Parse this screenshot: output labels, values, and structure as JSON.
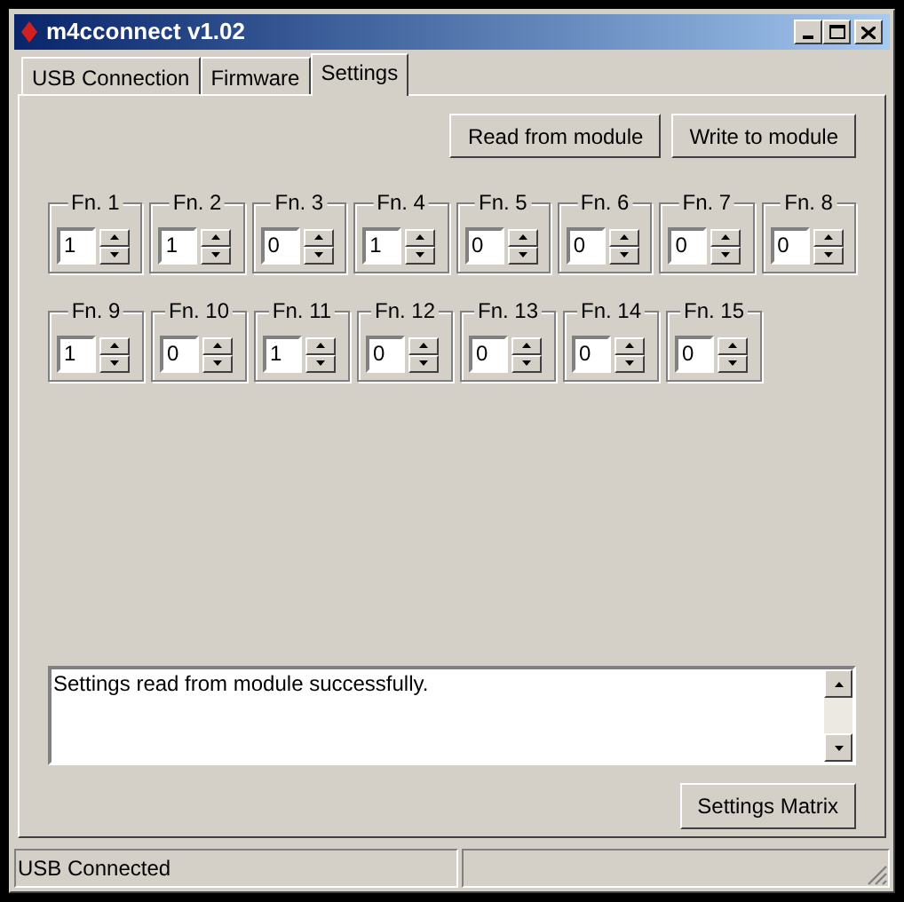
{
  "window": {
    "title": "m4cconnect v1.02"
  },
  "tabs": [
    {
      "label": "USB Connection",
      "selected": false
    },
    {
      "label": "Firmware",
      "selected": false
    },
    {
      "label": "Settings",
      "selected": true
    }
  ],
  "top_buttons": [
    "Read from module",
    "Write to module"
  ],
  "function_rows": [
    [
      {
        "label": "Fn. 1",
        "value": "1"
      },
      {
        "label": "Fn. 2",
        "value": "1"
      },
      {
        "label": "Fn. 3",
        "value": "0"
      },
      {
        "label": "Fn. 4",
        "value": "1"
      },
      {
        "label": "Fn. 5",
        "value": "0"
      },
      {
        "label": "Fn. 6",
        "value": "0"
      },
      {
        "label": "Fn. 7",
        "value": "0"
      },
      {
        "label": "Fn. 8",
        "value": "0"
      }
    ],
    [
      {
        "label": "Fn. 9",
        "value": "1"
      },
      {
        "label": "Fn. 10",
        "value": "0"
      },
      {
        "label": "Fn. 11",
        "value": "1"
      },
      {
        "label": "Fn. 12",
        "value": "0"
      },
      {
        "label": "Fn. 13",
        "value": "0"
      },
      {
        "label": "Fn. 14",
        "value": "0"
      },
      {
        "label": "Fn. 15",
        "value": "0"
      }
    ]
  ],
  "log": {
    "text": "Settings read from module successfully."
  },
  "bottom_button": "Settings Matrix",
  "status_bar": {
    "text": "USB Connected"
  }
}
